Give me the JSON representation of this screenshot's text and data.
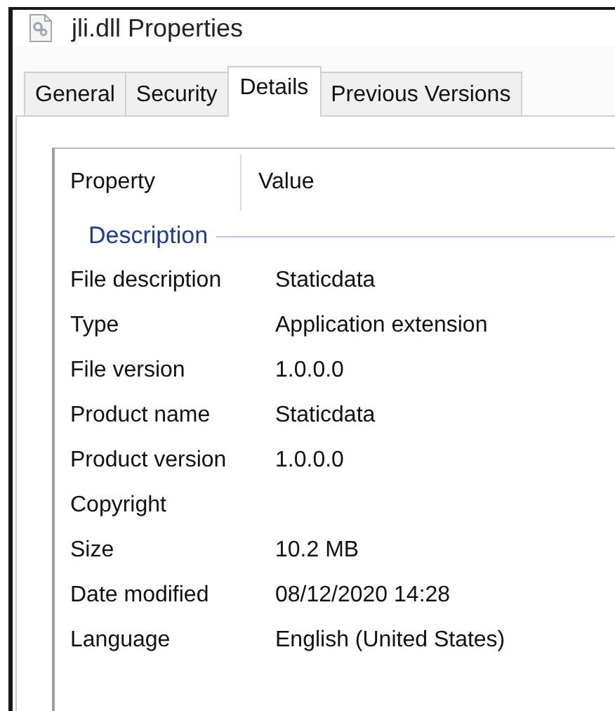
{
  "window": {
    "title": "jli.dll Properties"
  },
  "tabs": [
    {
      "label": "General",
      "selected": false
    },
    {
      "label": "Security",
      "selected": false
    },
    {
      "label": "Details",
      "selected": true
    },
    {
      "label": "Previous Versions",
      "selected": false
    }
  ],
  "table": {
    "columns": [
      "Property",
      "Value"
    ],
    "groups": [
      {
        "label": "Description",
        "rows": [
          {
            "property": "File description",
            "value": "Staticdata"
          },
          {
            "property": "Type",
            "value": "Application extension"
          },
          {
            "property": "File version",
            "value": "1.0.0.0"
          },
          {
            "property": "Product name",
            "value": "Staticdata"
          },
          {
            "property": "Product version",
            "value": "1.0.0.0"
          },
          {
            "property": "Copyright"
          },
          {
            "property": "Size",
            "value": "10.2 MB"
          },
          {
            "property": "Date modified",
            "value": "08/12/2020 14:28"
          },
          {
            "property": "Language",
            "value": "English (United States)"
          }
        ]
      }
    ]
  }
}
